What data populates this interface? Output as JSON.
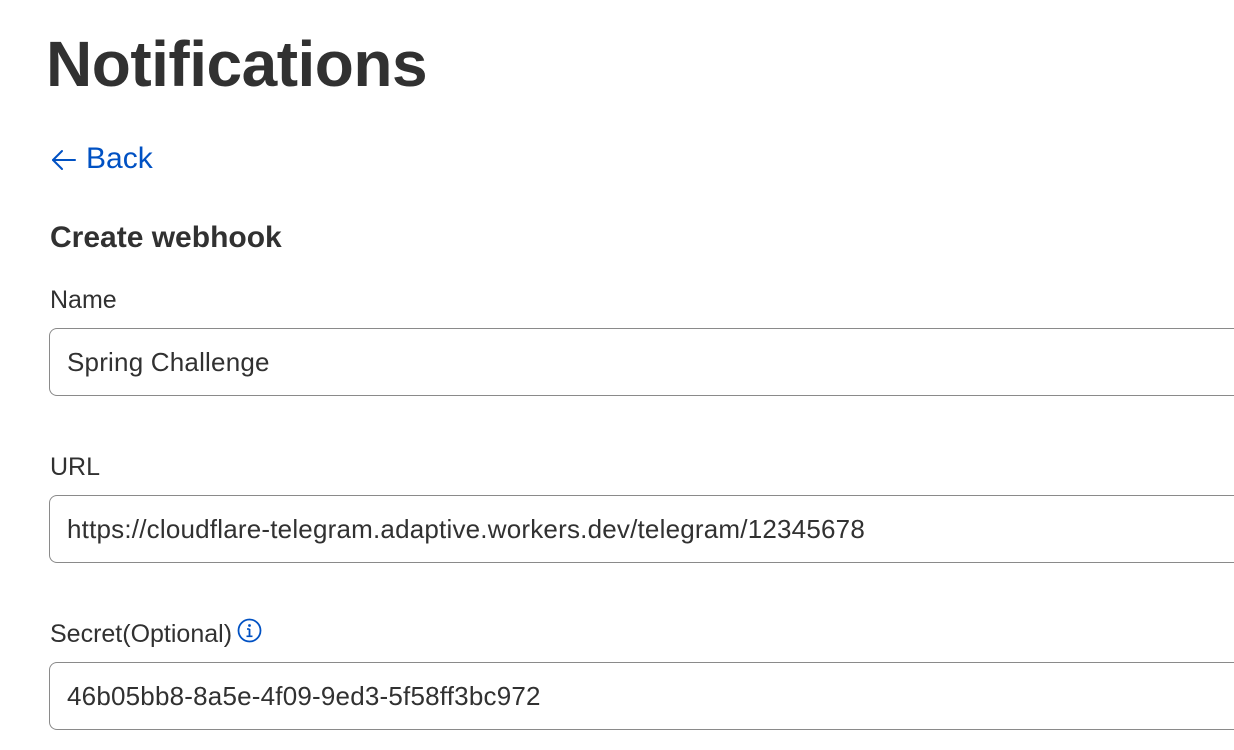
{
  "page": {
    "title": "Notifications"
  },
  "nav": {
    "back_label": "Back",
    "back_icon": "arrow-left-icon",
    "link_color": "#0051c3"
  },
  "form": {
    "title": "Create webhook",
    "name": {
      "label": "Name",
      "value": "Spring Challenge"
    },
    "url": {
      "label": "URL",
      "value": "https://cloudflare-telegram.adaptive.workers.dev/telegram/12345678"
    },
    "secret": {
      "label": "Secret(Optional)",
      "value": "46b05bb8-8a5e-4f09-9ed3-5f58ff3bc972",
      "info_icon": "info-icon"
    }
  }
}
